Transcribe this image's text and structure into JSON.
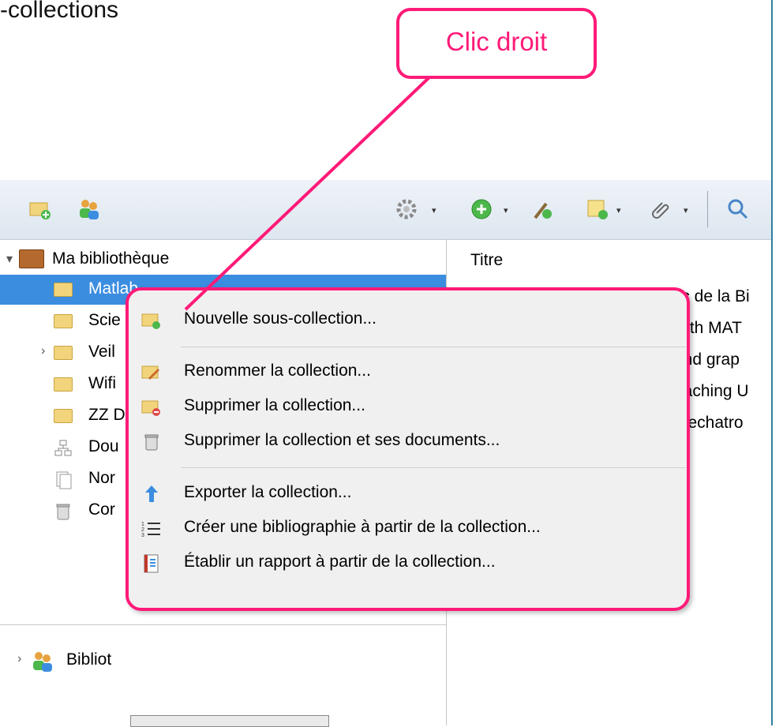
{
  "slide": {
    "title": "-collections"
  },
  "callout": {
    "label": "Clic droit"
  },
  "toolbar": {
    "buttons": [
      "new-collection",
      "new-group",
      "actions",
      "new-item",
      "add-by-identifier",
      "new-note",
      "attach"
    ]
  },
  "tree": {
    "library": "Ma bibliothèque",
    "items": [
      "Matlab",
      "Scie",
      "Veil",
      "Wifi",
      "ZZ D",
      "Dou",
      "Nor",
      "Cor"
    ],
    "group": "Bibliot"
  },
  "items_pane": {
    "column": "Titre",
    "rows": [
      "lic de la Bi",
      "with MAT",
      "and grap",
      "eaching U",
      "mechatro"
    ]
  },
  "context_menu": {
    "items": [
      "Nouvelle sous-collection...",
      "Renommer la collection...",
      "Supprimer la collection...",
      "Supprimer la collection et ses documents...",
      "Exporter la collection...",
      "Créer une bibliographie à partir de la collection...",
      "Établir un rapport à partir de la collection..."
    ]
  },
  "colors": {
    "accent": "#ff1a78",
    "selection": "#3b8de0"
  }
}
